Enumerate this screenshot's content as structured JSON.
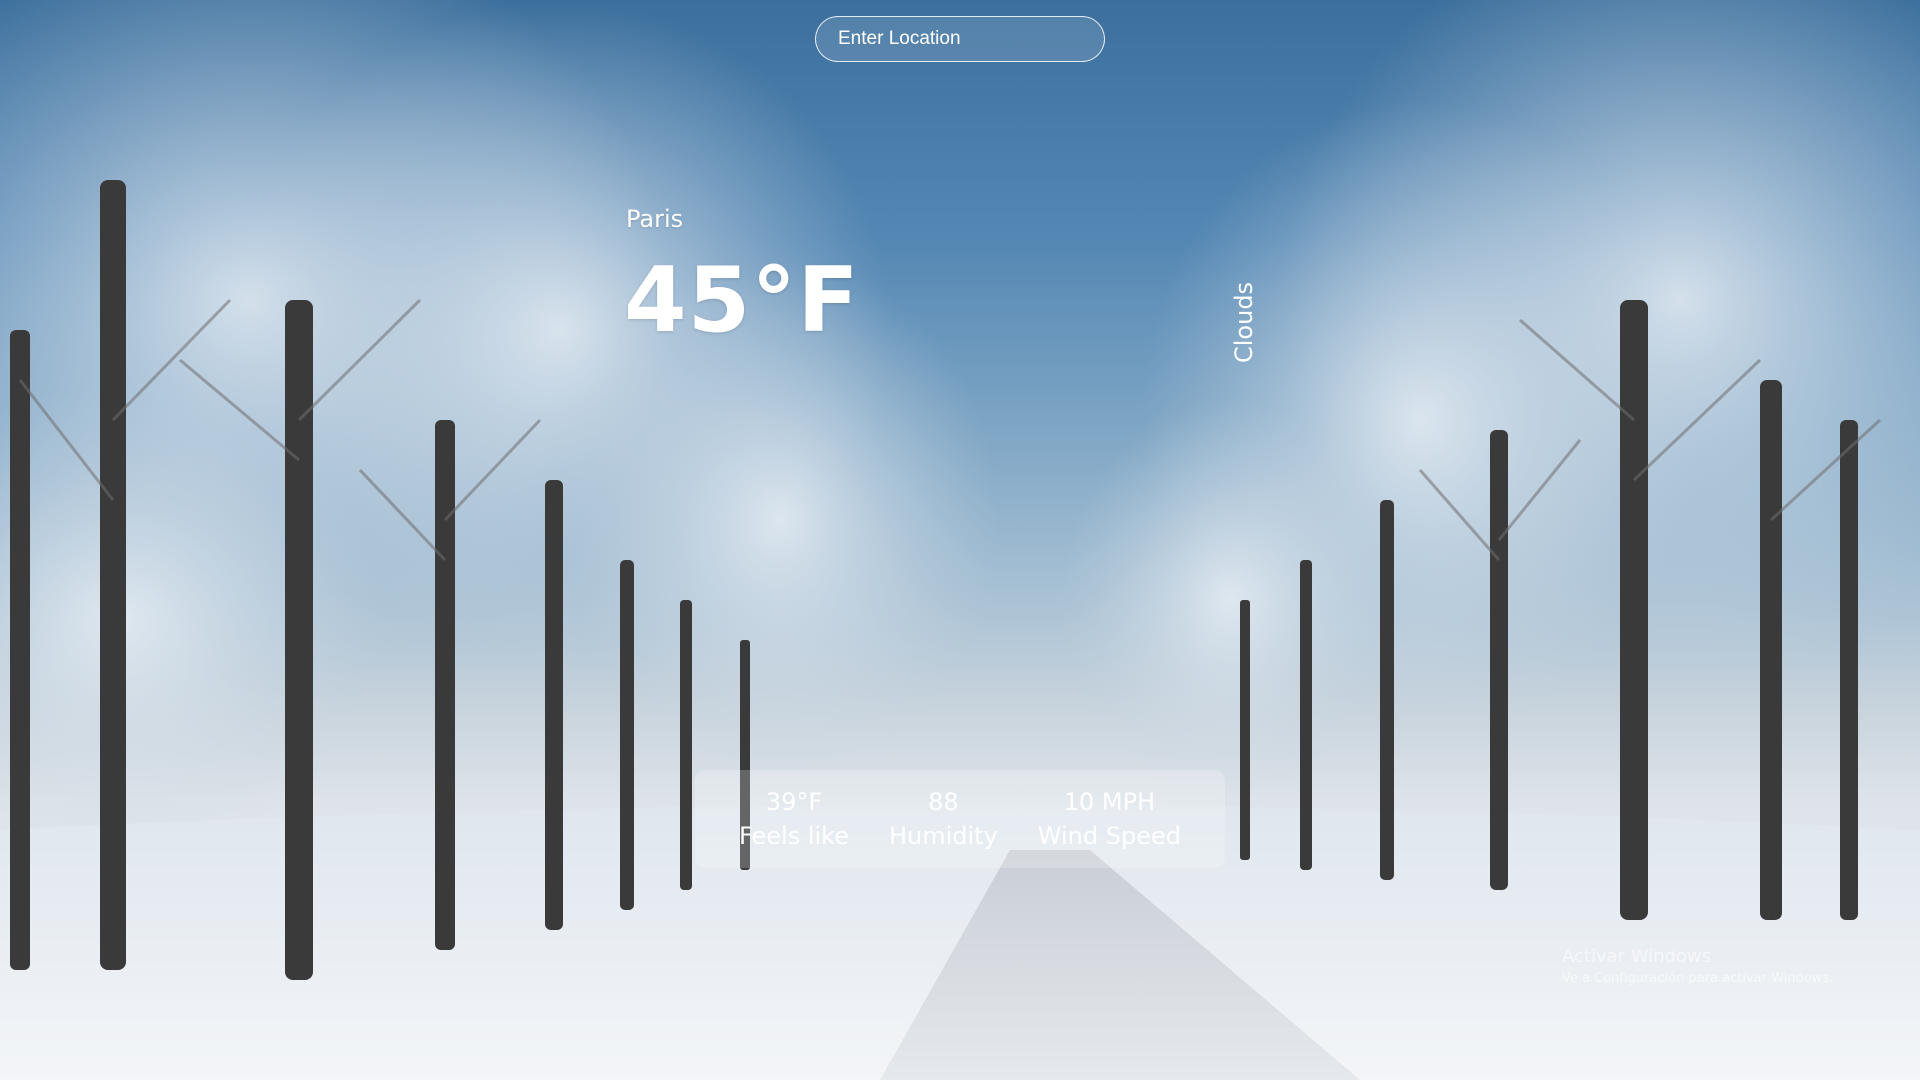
{
  "search": {
    "placeholder": "Enter Location"
  },
  "weather": {
    "location": "Paris",
    "temperature": "45°F",
    "description": "Clouds",
    "stats": [
      {
        "value": "39°F",
        "label": "Feels like"
      },
      {
        "value": "88",
        "label": "Humidity"
      },
      {
        "value": "10 MPH",
        "label": "Wind Speed"
      }
    ]
  },
  "os_watermark": {
    "title": "Activar Windows",
    "subtitle": "Ve a Configuración para activar Windows."
  },
  "colors": {
    "sky_top": "#3c6f9d",
    "snow": "#eef1f4",
    "text": "#ffffff"
  }
}
